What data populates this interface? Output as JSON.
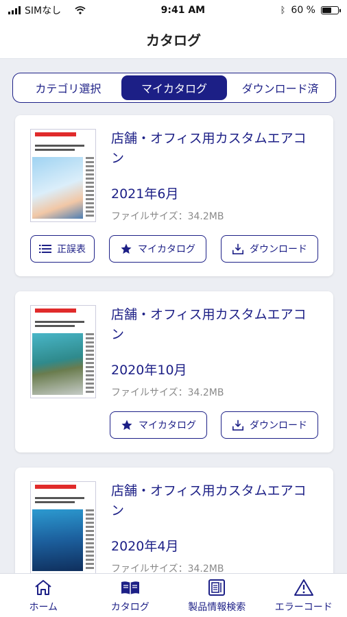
{
  "status": {
    "carrier": "SIMなし",
    "time": "9:41 AM",
    "battery_text": "60 %",
    "battery_level": 0.6
  },
  "header": {
    "title": "カタログ"
  },
  "tabs": [
    {
      "label": "カテゴリ選択",
      "active": false
    },
    {
      "label": "マイカタログ",
      "active": true
    },
    {
      "label": "ダウンロード済",
      "active": false
    }
  ],
  "catalogs": [
    {
      "title": "店舗・オフィス用カスタムエアコン",
      "date": "2021年6月",
      "file_size": "ファイルサイズ：34.2MB",
      "actions": {
        "errata": "正誤表",
        "my_catalog": "マイカタログ",
        "download": "ダウンロード"
      }
    },
    {
      "title": "店舗・オフィス用カスタムエアコン",
      "date": "2020年10月",
      "file_size": "ファイルサイズ：34.2MB",
      "actions": {
        "my_catalog": "マイカタログ",
        "download": "ダウンロード"
      }
    },
    {
      "title": "店舗・オフィス用カスタムエアコン",
      "date": "2020年4月",
      "file_size": "ファイルサイズ：34.2MB"
    }
  ],
  "bottom_nav": [
    {
      "label": "ホーム",
      "icon": "home-icon"
    },
    {
      "label": "カタログ",
      "icon": "book-icon"
    },
    {
      "label": "製品情報検索",
      "icon": "product-search-icon"
    },
    {
      "label": "エラーコード",
      "icon": "warning-icon"
    }
  ],
  "colors": {
    "accent": "#1c1f86",
    "background": "#eceef3"
  }
}
